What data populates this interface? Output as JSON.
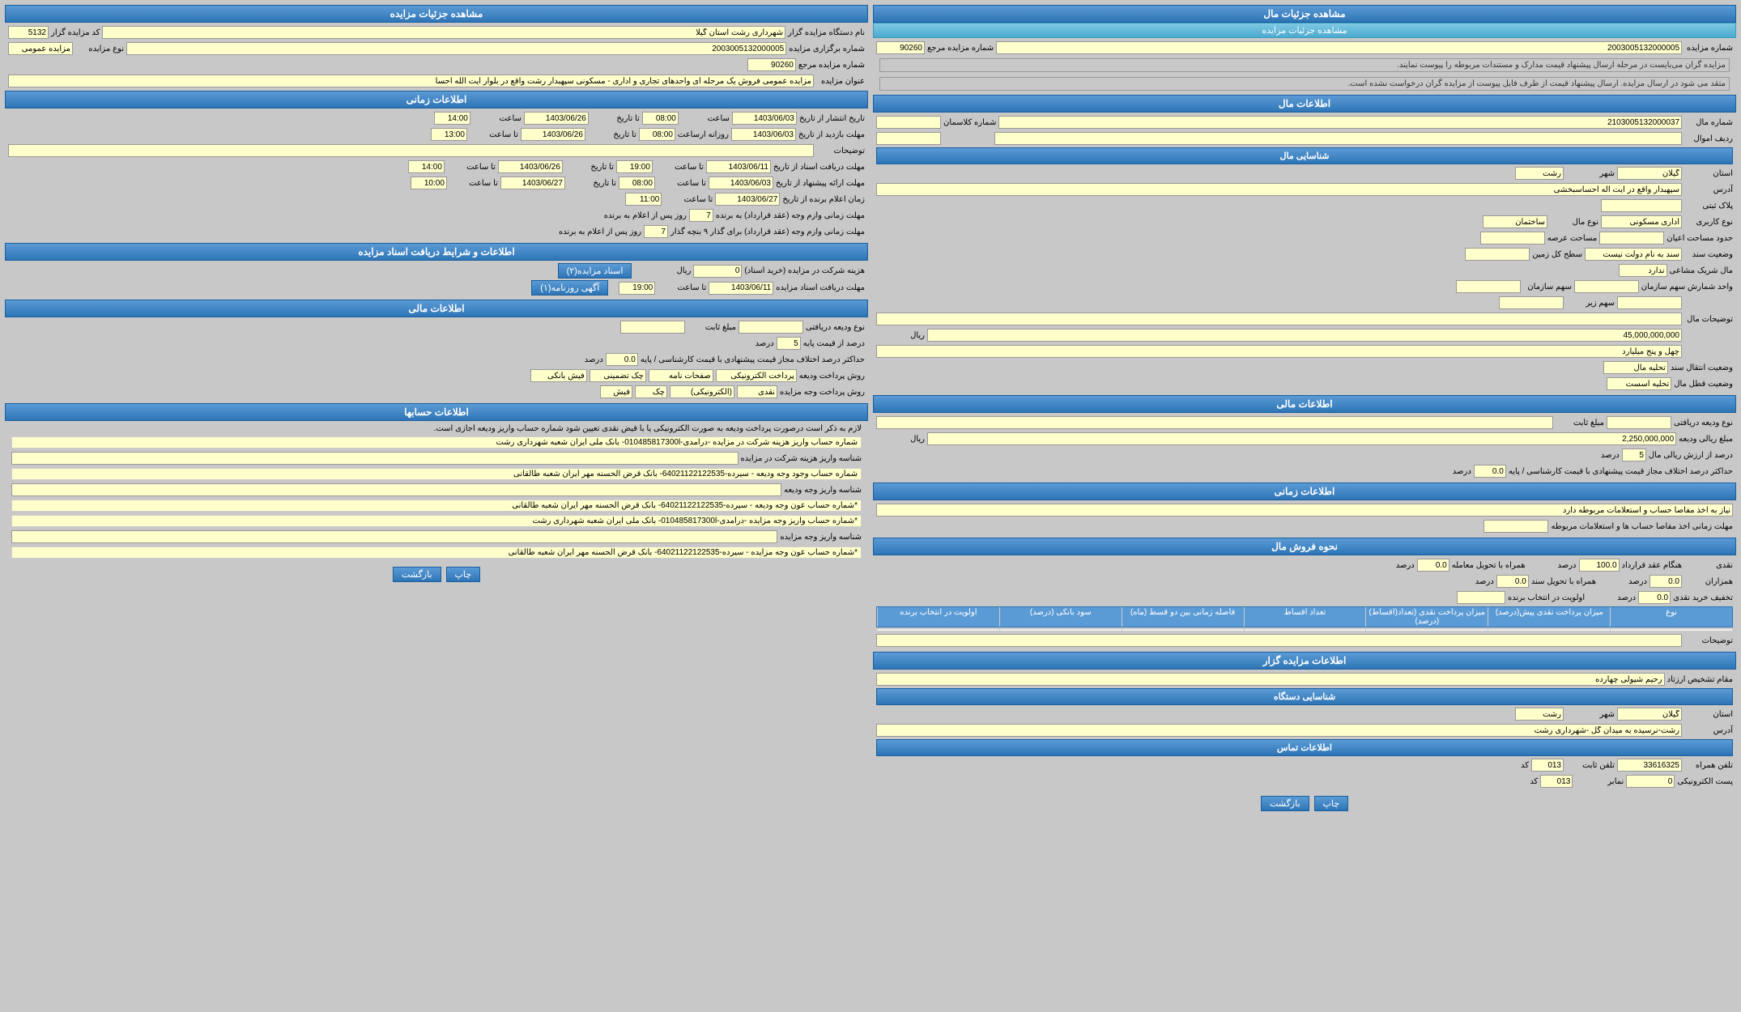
{
  "left_panel": {
    "main_title": "مشاهده جزئیات مال",
    "sub_title": "مشاهده جزئیات مزایده",
    "fields": {
      "auction_number": "2003005132000005",
      "ref_number": "90260",
      "notice1": "مزایده گران می‌بایست در مرحله ارسال پیشنهاد قیمت مدارک و مستندات مربوطه را پیوست نمایند.",
      "notice2": "متقد می شود در ارسال مزایده. ارسال پیشنهاد قیمت از طرف فایل پیوست از مزایده گران درخواست نشده است."
    },
    "property_info": {
      "title": "اطلاعات مال",
      "property_number": "2103005132000037",
      "asset_number": "",
      "property_class": "شماره کلاسمان",
      "asset_row": "ردیف اموال",
      "property_amount_title": "شناسایی مال",
      "province": "گیلان",
      "city": "رشت",
      "address": "سپهبدار واقع در آیت اله احساسبخشی",
      "postal_code": "",
      "property_type": "ساختمان",
      "usage_type": "اداری مسکونی",
      "surface_area": "",
      "land_area": "",
      "has_partner": "ندارد",
      "partner_shares": "",
      "ownership": "سند به نام دولت نیست",
      "org_share": "واحد شمارش سهم سازمان",
      "property_notes": "",
      "base_price_per_share": "45,000,000,000",
      "base_price_letters": "چهل و پنج میلیارد",
      "transfer_status": "تحلیه مال",
      "financial_status": "تحلیه اسست"
    },
    "financial_info": {
      "title": "اطلاعات مالی",
      "deposit_type": "نوع ودیعه دریافتی",
      "fixed_amount": "مبلغ ثابت",
      "rial_value": "2,250,000,000",
      "base_price_percent": "5",
      "deviation_percent": "0.0"
    },
    "time_info": {
      "title": "اطلاعات زمانی",
      "account_note": "نیاز به اخذ مفاصا حساب و استعلامات مربوطه دارد",
      "delivery_note": "مهلت زمانی اخذ مفاصا حساب ها و استعلامات مربوطه"
    },
    "sale_method": {
      "title": "نحوه فروش مال",
      "cash": "نقدی",
      "contract_percent": "100.0",
      "installment_percent": "0.0",
      "broker_percent": "0.0",
      "cash_discount": "0.0",
      "bond_convert": "0.0",
      "winner_priority": "اولویت در انتخاب برنده"
    },
    "table_headers": [
      "نوع",
      "میزان پرداخت نقدی پیش(درصد)",
      "میزان پرداخت نقدی (تعداد(اقساط) (درصد)",
      "تعداد اقساط",
      "فاصله زمانی بین دو قسط (ماه)",
      "سود بانکی (درصد)",
      "اولویت در انتخاب برنده"
    ],
    "auctioneer_info": {
      "title": "اطلاعات مزایده گزار",
      "agent": "رحیم شیولی چهارده",
      "province": "گیلان",
      "city": "رشت",
      "address": "رشت-نرسیده به میدان گل -شهرداری رشت",
      "phone_fixed": "33616325",
      "phone_code": "013",
      "fax_code": "013",
      "fax_num": "0"
    },
    "btn_back": "بازگشت",
    "btn_print": "چاپ"
  },
  "right_panel": {
    "main_title": "مشاهده جزئیات مزایده",
    "auction_organizer": "شهرداری رشت استان گیلا",
    "auction_code": "5132",
    "auction_number": "2003005132000005",
    "ref_number": "90260",
    "auction_type": "مزایده عمومی",
    "auction_title": "مزایده عمومی فروش یک مرحله ای واحدهای تجاری و اداری - مسکونی سپهبدار رشت واقع در بلوار آیت الله احسا",
    "time_info": {
      "title": "اطلاعات زمانی",
      "start_date": "1403/06/03",
      "start_time": "08:00",
      "end_date": "1403/06/26",
      "end_time": "14:00",
      "deadline_date": "1403/06/03",
      "deadline_time": "08:00",
      "deadline_end_date": "1403/06/26",
      "deadline_end_time": "13:00",
      "notes": "",
      "doc_deadline_from": "1403/06/11",
      "doc_deadline_from_time": "19:00",
      "doc_deadline_to": "1403/06/26",
      "doc_deadline_to_time": "14:00",
      "pre_tender_from": "1403/06/03",
      "pre_tender_from_time": "08:00",
      "pre_tender_to": "1403/06/27",
      "pre_tender_to_time": "10:00",
      "winner_announce_from": "1403/06/27",
      "winner_announce_from_time": "11:00",
      "contract_days": "7",
      "contract_days2": "7"
    },
    "tender_docs": {
      "title": "اطلاعات و شرایط دریافت اسناد مزایده",
      "participation_fee": "0",
      "currency": "ریال",
      "btn_buy": "اسناد مزایده(۲)",
      "btn_online": "آگهی روزنامه(۱)",
      "deadline_start": "1403/06/11",
      "deadline_end_time": "19:00"
    },
    "financial_info": {
      "title": "اطلاعات مالی",
      "deposit_type": "نوع ودیعه دریافتی",
      "fixed_amount": "مبلغ ثابت",
      "base_price_percent": "5",
      "deviation_percent": "0.0",
      "payment_methods_title": "روش پرداخت ودیعه",
      "payment_method1": "پرداخت الکترونیکی",
      "payment_method2": "صفحات نامه",
      "payment_method3": "چک تضمینی",
      "payment_method4": "فیش بانکی",
      "payment_method_cash": "روش پرداخت وجه مزایده",
      "cash": "نقدی",
      "electronic": "(الکترونیکی)",
      "check": "چک",
      "fiche": "فیش"
    },
    "account_info": {
      "title": "اطلاعات حسابها",
      "note": "لازم به ذکر است درصورت پرداخت ودیعه به صورت الکترونیکی یا با قیض نقدی تعیین شود شماره حساب واریز ودیعه اجازی است.",
      "accounts": [
        "شماره حساب واریز هزینه شرکت در مزایده -درامدی-010485817300l- بانک ملی ایران شعبه شهرداری رشت",
        "شناسه واریز هزینه شرکت در مزایده",
        "شماره حساب وجود وجه ودیعه - سیرده-64021122122535- بانک قرض الحسنه مهر ایران شعبه طالقانی",
        "شناسه واریز وجه ودیعه",
        "*شماره حساب عون وجه ودیعه - سیرده-64021122122535- بانک قرض الحسنه مهر ایران شعبه طالقانی",
        "*شماره حساب واریز وجه مزایده -درامدی-010485817300l- بانک ملی ایران شعبه شهرداری رشت",
        "شناسه واریز وجه مزایده",
        "*شماره حساب عون وجه مزایده - سیرده-64021122122535- بانک قرض الحسنه مهر ایران شعبه طالقانی"
      ]
    },
    "btn_print": "چاپ",
    "btn_back": "بازگشت"
  }
}
